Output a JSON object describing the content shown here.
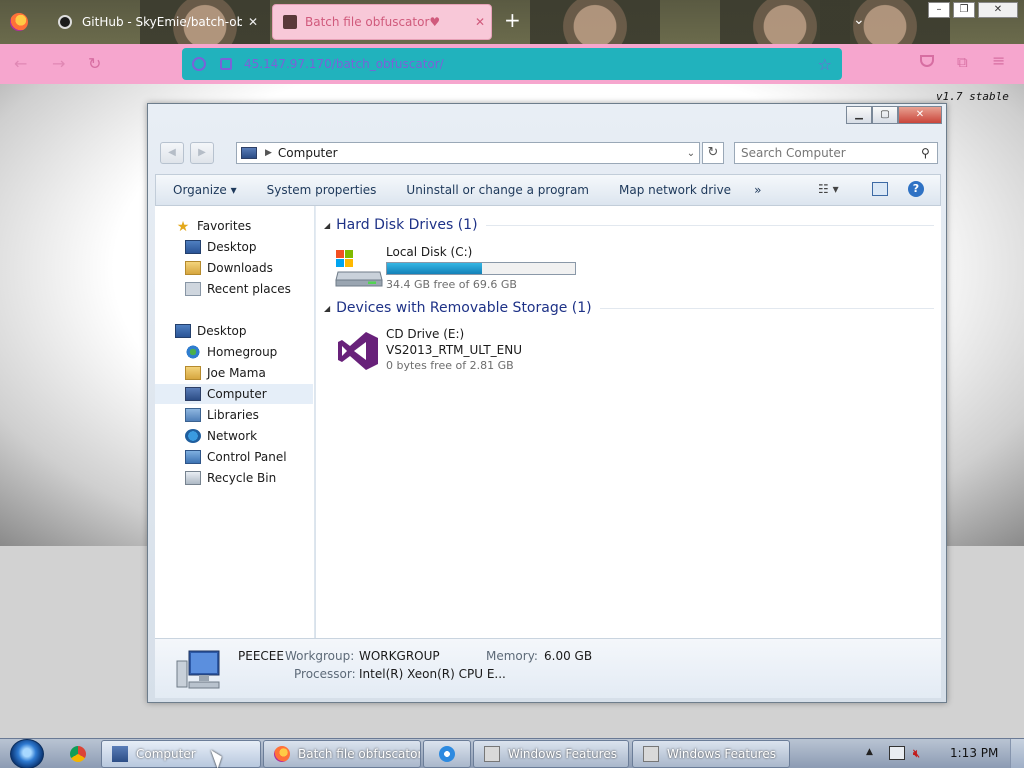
{
  "browser": {
    "tabs": [
      {
        "title": "GitHub - SkyEmie/batch-obfu",
        "active": false
      },
      {
        "title": "Batch file obfuscator♥",
        "active": true
      }
    ],
    "url": "45.147.97.170/batch_obfuscator/",
    "icons": [
      "firefox-icon",
      "github-icon",
      "new-tab-icon",
      "star-icon",
      "pocket-icon",
      "extensions-icon",
      "menu-icon"
    ],
    "accent_colors": {
      "tab_active": "#f8c8d8",
      "navbar": "#f6a6ce",
      "urlbar": "#21b2bd",
      "url_text": "#7a62d8"
    }
  },
  "page": {
    "version_label": "v1.7 stable"
  },
  "explorer": {
    "address_path": "Computer",
    "search_placeholder": "Search Computer",
    "commands": [
      "Organize ▾",
      "System properties",
      "Uninstall or change a program",
      "Map network drive",
      "»"
    ],
    "nav": {
      "favorites": "Favorites",
      "favorite_items": [
        "Desktop",
        "Downloads",
        "Recent places"
      ],
      "desktop": "Desktop",
      "desktop_items": [
        "Homegroup",
        "Joe Mama",
        "Computer",
        "Libraries",
        "Network",
        "Control Panel",
        "Recycle Bin"
      ],
      "selected": "Computer"
    },
    "groups": {
      "hdd_title": "Hard Disk Drives (1)",
      "removable_title": "Devices with Removable Storage (1)"
    },
    "local_disk": {
      "name": "Local Disk (C:)",
      "free_text": "34.4 GB free of 69.6 GB",
      "used_fraction": 0.506
    },
    "cd_drive": {
      "name": "CD Drive (E:)",
      "label": "VS2013_RTM_ULT_ENU",
      "free_text": "0 bytes free of 2.81 GB"
    },
    "details": {
      "pc_name": "PEECEE",
      "workgroup_label": "Workgroup:",
      "workgroup": "WORKGROUP",
      "memory_label": "Memory:",
      "memory": "6.00 GB",
      "processor_label": "Processor:",
      "processor": "Intel(R) Xeon(R) CPU E..."
    }
  },
  "taskbar": {
    "buttons": [
      "Computer",
      "Batch file obfuscator...",
      "Windows Features",
      "Windows Features"
    ],
    "clock": "1:13 PM"
  }
}
